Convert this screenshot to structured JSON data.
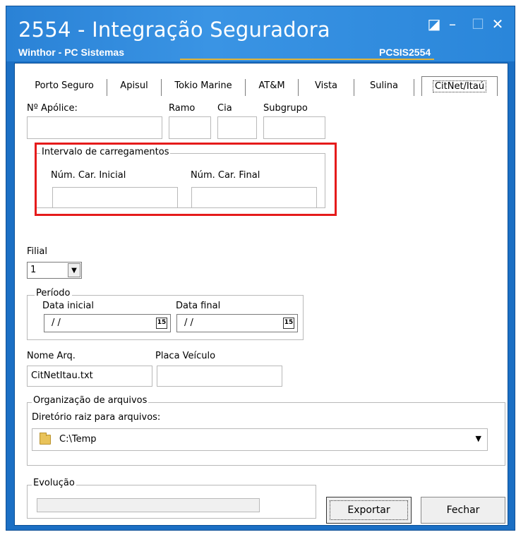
{
  "window": {
    "title": "2554 - Integração Seguradora",
    "subtitle": "Winthor - PC Sistemas",
    "code": "PCSIS2554",
    "controls": {
      "restore": "◪",
      "minimize": "–",
      "maximize": "☐",
      "close": "✕"
    }
  },
  "tabs": [
    {
      "label": "Porto Seguro"
    },
    {
      "label": "Apisul"
    },
    {
      "label": "Tokio Marine"
    },
    {
      "label": "AT&M"
    },
    {
      "label": "Vista"
    },
    {
      "label": "Sulina"
    },
    {
      "label": "CitNet/Itaú",
      "active": true
    }
  ],
  "policy": {
    "apolice_label": "Nº Apólice:",
    "ramo_label": "Ramo",
    "cia_label": "Cia",
    "subgrupo_label": "Subgrupo"
  },
  "intervalo": {
    "title": "Intervalo de carregamentos",
    "inicial_label": "Núm. Car. Inicial",
    "final_label": "Núm. Car. Final"
  },
  "filial": {
    "label": "Filial",
    "value": "1"
  },
  "periodo": {
    "title": "Período",
    "inicial_label": "Data inicial",
    "final_label": "Data final",
    "inicial_value": "/ /",
    "final_value": "/ /",
    "calendar_glyph": "15"
  },
  "arquivo": {
    "nome_label": "Nome Arq.",
    "nome_value": "CitNetItau.txt",
    "placa_label": "Placa Veículo"
  },
  "organizacao": {
    "title": "Organização de arquivos",
    "dir_label": "Diretório raiz para arquivos:",
    "dir_value": "C:\\Temp"
  },
  "evolucao": {
    "title": "Evolução",
    "progress": 0
  },
  "buttons": {
    "exportar": "Exportar",
    "fechar": "Fechar"
  },
  "colors": {
    "titlebar": "#2a82d6",
    "highlight": "#e51b1b",
    "accent_line": "#e0b43a"
  }
}
